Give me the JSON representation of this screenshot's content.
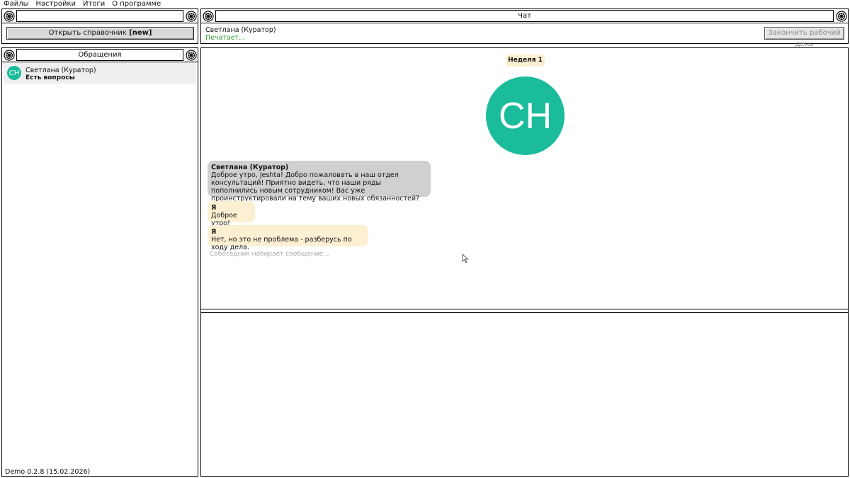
{
  "menu": [
    "Файлы",
    "Настройки",
    "Итоги",
    "О программе"
  ],
  "left_top": {
    "open_ref_label": "Открыть справочник ",
    "open_ref_badge": "[new]"
  },
  "requests": {
    "title": "Обращения",
    "items": [
      {
        "initials": "CH",
        "name": "Светлана (Куратор)",
        "status": "Есть вопросы"
      }
    ]
  },
  "version": "Demo 0.2.8 (15.02.2026)",
  "chat": {
    "title": "Чат",
    "contact_name": "Светлана (Куратор)",
    "contact_status": "Печатает...",
    "end_day_label": "Закончить рабочий день",
    "week_badge": "Неделя 1",
    "big_avatar": "CH",
    "messages": [
      {
        "from": "Светлана (Куратор)",
        "text": "Доброе утро, Jeshta! Добро пожаловать в наш отдел консультаций! Приятно видеть, что наши ряды пополнились новым сотрудником! Вас уже проинструктировали на тему ваших новых обязанностей?",
        "side": "in"
      },
      {
        "from": "Я",
        "text": "Доброе утро!",
        "side": "out"
      },
      {
        "from": "Я",
        "text": "Нет, но это не проблема - разберусь по ходу дела.",
        "side": "out"
      }
    ],
    "typing_hint": "Собеседник набирает сообщение..."
  },
  "colors": {
    "accent": "#1abc9c",
    "incoming_bubble": "#d0d0d0",
    "outgoing_bubble": "#fdf0d2",
    "status_green": "#2e9b2e"
  }
}
